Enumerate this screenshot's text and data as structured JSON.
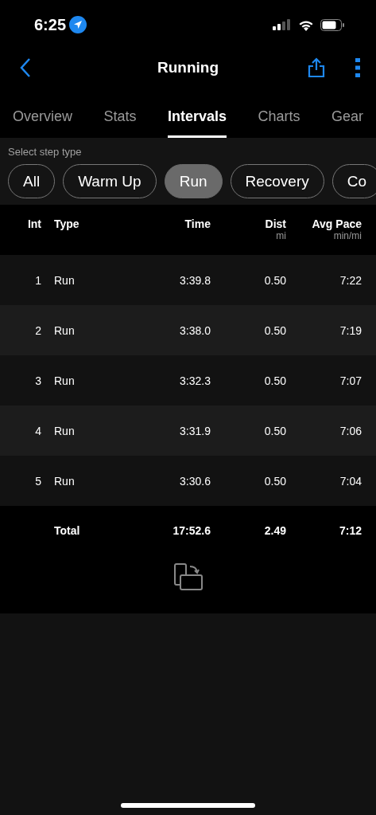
{
  "status_bar": {
    "time": "6:25"
  },
  "nav": {
    "title": "Running"
  },
  "tabs": [
    {
      "label": "Overview",
      "selected": false
    },
    {
      "label": "Stats",
      "selected": false
    },
    {
      "label": "Intervals",
      "selected": true
    },
    {
      "label": "Charts",
      "selected": false
    },
    {
      "label": "Gear",
      "selected": false
    }
  ],
  "filter": {
    "label": "Select step type",
    "chips": [
      {
        "label": "All",
        "selected": false
      },
      {
        "label": "Warm Up",
        "selected": false
      },
      {
        "label": "Run",
        "selected": true
      },
      {
        "label": "Recovery",
        "selected": false
      },
      {
        "label": "Co",
        "selected": false
      }
    ]
  },
  "table": {
    "columns": [
      {
        "label": "Int"
      },
      {
        "label": "Type"
      },
      {
        "label": "Time"
      },
      {
        "label": "Dist",
        "unit": "mi"
      },
      {
        "label": "Avg Pace",
        "unit": "min/mi"
      }
    ],
    "rows": [
      [
        "1",
        "Run",
        "3:39.8",
        "0.50",
        "7:22"
      ],
      [
        "2",
        "Run",
        "3:38.0",
        "0.50",
        "7:19"
      ],
      [
        "3",
        "Run",
        "3:32.3",
        "0.50",
        "7:07"
      ],
      [
        "4",
        "Run",
        "3:31.9",
        "0.50",
        "7:06"
      ],
      [
        "5",
        "Run",
        "3:30.6",
        "0.50",
        "7:04"
      ]
    ],
    "total": {
      "label": "Total",
      "time": "17:52.6",
      "dist": "2.49",
      "pace": "7:12"
    }
  }
}
